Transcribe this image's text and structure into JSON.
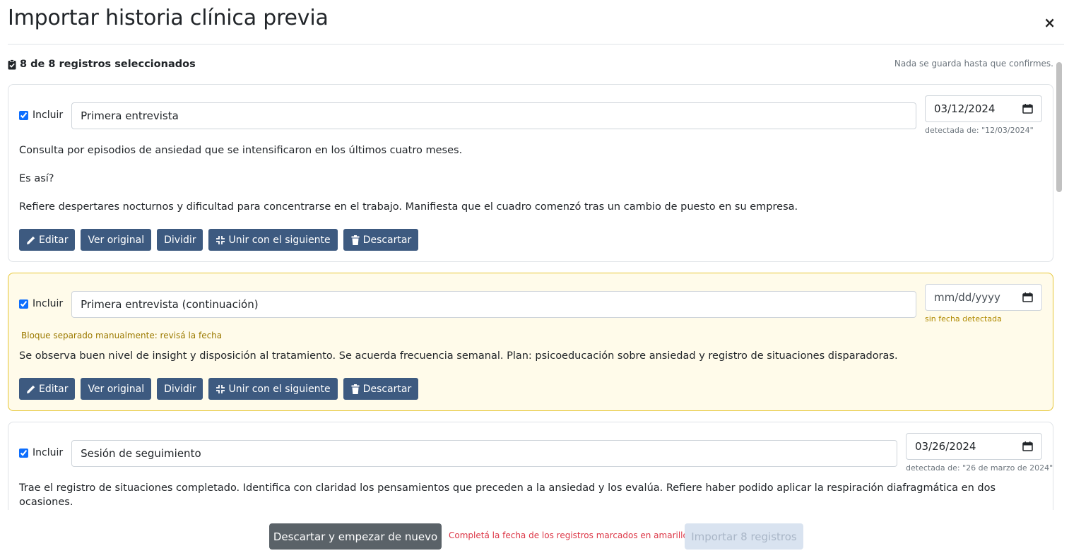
{
  "modal": {
    "title": "Importar historia clínica previa",
    "close": "×"
  },
  "summary": {
    "selected": "8 de 8 registros seleccionados",
    "note": "Nada se guarda hasta que confirmes."
  },
  "records": [
    {
      "include_label": "Incluir",
      "checked": true,
      "title": "Primera entrevista",
      "date": "03/12/2024",
      "date_hint": "detectada de: \"12/03/2024\"",
      "note": "",
      "paragraphs": [
        "Consulta por episodios de ansiedad que se intensificaron en los últimos cuatro meses.",
        "Es así?",
        "Refiere despertares nocturnos y dificultad para concentrarse en el trabajo. Manifiesta que el cuadro comenzó tras un cambio de puesto en su empresa."
      ]
    },
    {
      "include_label": "Incluir",
      "checked": true,
      "title": "Primera entrevista (continuación)",
      "date": "mm/dd/yyyy",
      "date_hint": "sin fecha detectada",
      "note": "Bloque separado manualmente: revisá la fecha",
      "paragraphs": [
        "Se observa buen nivel de insight y disposición al tratamiento. Se acuerda frecuencia semanal. Plan: psicoeducación sobre ansiedad y registro de situaciones disparadoras."
      ]
    },
    {
      "include_label": "Incluir",
      "checked": true,
      "title": "Sesión de seguimiento",
      "date": "03/26/2024",
      "date_hint": "detectada de: \"26 de marzo de 2024\"",
      "note": "",
      "paragraphs": [
        "Trae el registro de situaciones completado. Identifica con claridad los pensamientos que preceden a la ansiedad y los evalúa. Refiere haber podido aplicar la respiración diafragmática en dos ocasiones."
      ]
    }
  ],
  "actions": {
    "edit": "Editar",
    "view_original": "Ver original",
    "split": "Dividir",
    "merge_next": "Unir con el siguiente",
    "discard": "Descartar"
  },
  "footer": {
    "discard_all": "Descartar y empezar de nuevo",
    "warning": "Completá la fecha de los registros marcados en amarillo",
    "import": "Importar 8 registros"
  },
  "colors": {
    "action_button": "#3d5a80",
    "warn_background": "#fffbea",
    "warn_border": "#e6c533",
    "danger_text": "#dc3545",
    "discard_button": "#5a6268",
    "import_disabled": "#d9e3f0"
  }
}
